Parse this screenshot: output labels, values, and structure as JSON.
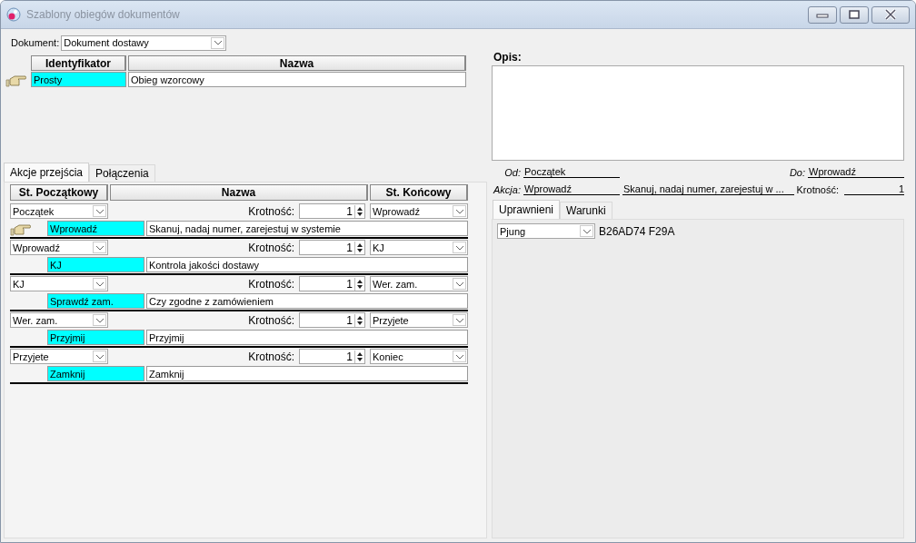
{
  "window": {
    "title": "Szablony obiegów dokumentów"
  },
  "document": {
    "label": "Dokument:",
    "value": "Dokument dostawy"
  },
  "templates": {
    "columns": [
      "Identyfikator",
      "Nazwa"
    ],
    "rows": [
      {
        "id": "Prosty",
        "name": "Obieg wzorcowy",
        "current": true
      }
    ]
  },
  "left_tabs": [
    {
      "label": "Akcje przejścia",
      "selected": true
    },
    {
      "label": "Połączenia",
      "selected": false
    }
  ],
  "transitions": {
    "columns": [
      "St. Początkowy",
      "Nazwa",
      "St. Końcowy"
    ],
    "rows": [
      {
        "from": "Początek",
        "multiplicity_label": "Krotność:",
        "multiplicity": "1",
        "to": "Wprowadź",
        "action": "Wprowadź",
        "description": "Skanuj, nadaj numer, zarejestuj w systemie",
        "current": true
      },
      {
        "from": "Wprowadź",
        "multiplicity_label": "Krotność:",
        "multiplicity": "1",
        "to": "KJ",
        "action": "KJ",
        "description": "Kontrola jakości dostawy",
        "current": false
      },
      {
        "from": "KJ",
        "multiplicity_label": "Krotność:",
        "multiplicity": "1",
        "to": "Wer. zam.",
        "action": "Sprawdź zam.",
        "description": "Czy zgodne z zamówieniem",
        "current": false
      },
      {
        "from": "Wer. zam.",
        "multiplicity_label": "Krotność:",
        "multiplicity": "1",
        "to": "Przyjete",
        "action": "Przyjmij",
        "description": "Przyjmij",
        "current": false
      },
      {
        "from": "Przyjete",
        "multiplicity_label": "Krotność:",
        "multiplicity": "1",
        "to": "Koniec",
        "action": "Zamknij",
        "description": "Zamknij",
        "current": false
      }
    ]
  },
  "details": {
    "description_label": "Opis:",
    "from_label": "Od:",
    "from": "Początek",
    "to_label": "Do:",
    "to": "Wprowadź",
    "action_label": "Akcja:",
    "action": "Wprowadź",
    "action_description": "Skanuj, nadaj numer, zarejestuj w ...",
    "multiplicity_label": "Krotność:",
    "multiplicity": "1"
  },
  "right_tabs": [
    {
      "label": "Uprawnieni",
      "selected": true
    },
    {
      "label": "Warunki",
      "selected": false
    }
  ],
  "permissions": [
    {
      "user": "Pjung",
      "code": "B26AD74 F29A"
    }
  ]
}
